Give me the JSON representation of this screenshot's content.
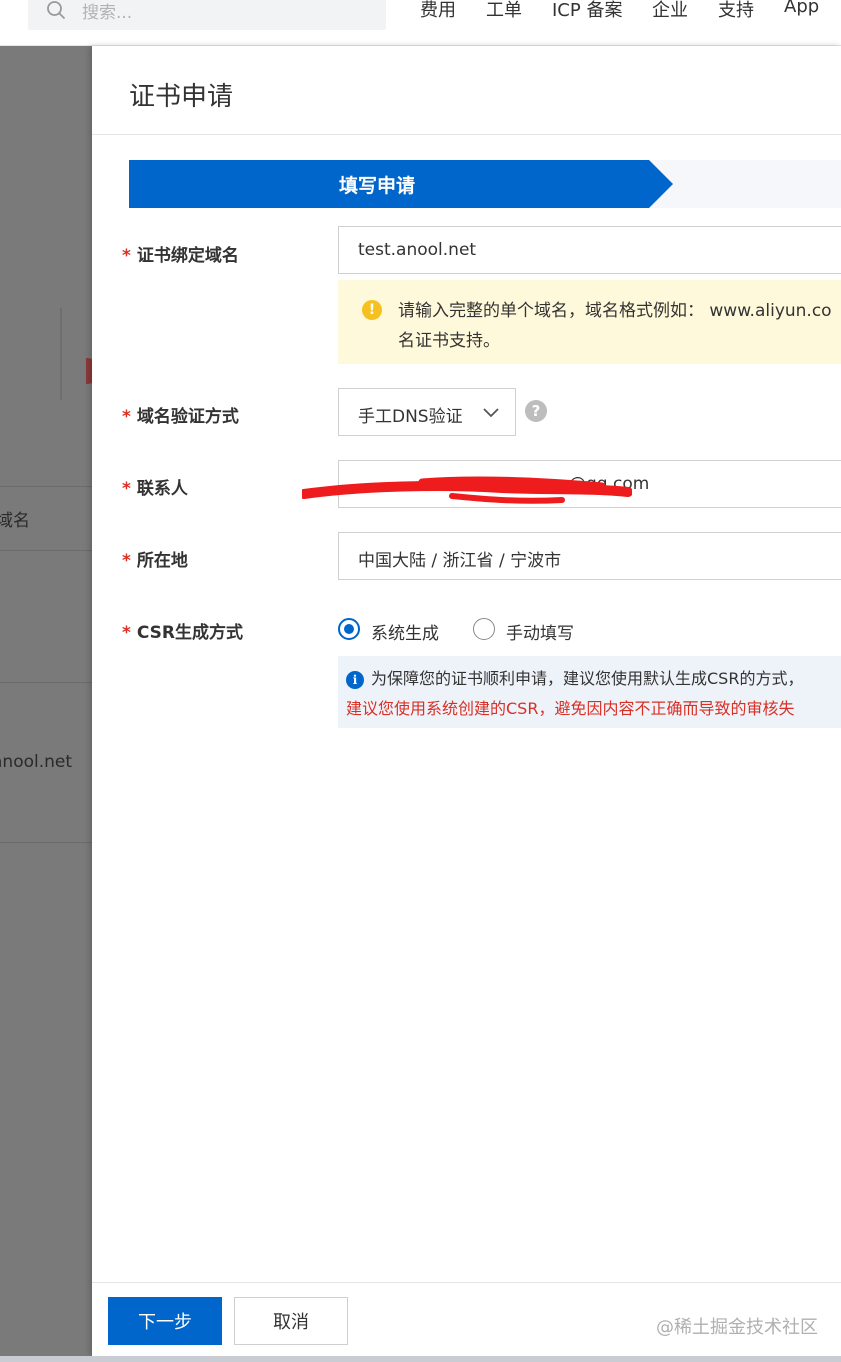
{
  "topbar": {
    "search_placeholder": "搜索...",
    "nav": [
      "费用",
      "工单",
      "ICP 备案",
      "企业",
      "支持",
      "App"
    ]
  },
  "background": {
    "column_header": "域名",
    "domain_cell": "anool.net"
  },
  "drawer": {
    "title": "证书申请",
    "step_active": "填写申请",
    "form": {
      "domain_label": "证书绑定域名",
      "domain_value": "test.anool.net",
      "domain_hint": "请输入完整的单个域名，域名格式例如： www.aliyun.co",
      "domain_hint_line2": "名证书支持。",
      "verify_label": "域名验证方式",
      "verify_value": "手工DNS验证",
      "contact_label": "联系人",
      "contact_value": "@qq.com",
      "location_label": "所在地",
      "location_value": "中国大陆 / 浙江省 / 宁波市",
      "csr_label": "CSR生成方式",
      "csr_option_system": "系统生成",
      "csr_option_manual": "手动填写",
      "csr_selected": "系统生成",
      "csr_info_line1": "为保障您的证书顺利申请，建议您使用默认生成CSR的方式，",
      "csr_info_line2": "建议您使用系统创建的CSR，避免因内容不正确而导致的审核失"
    },
    "footer": {
      "next_button": "下一步",
      "cancel_button": "取消",
      "watermark": "@稀土掘金技术社区"
    }
  },
  "colors": {
    "primary": "#0066cc",
    "required": "#d93026",
    "warning_bg": "#fff9db",
    "info_bg": "#eef3fa"
  }
}
